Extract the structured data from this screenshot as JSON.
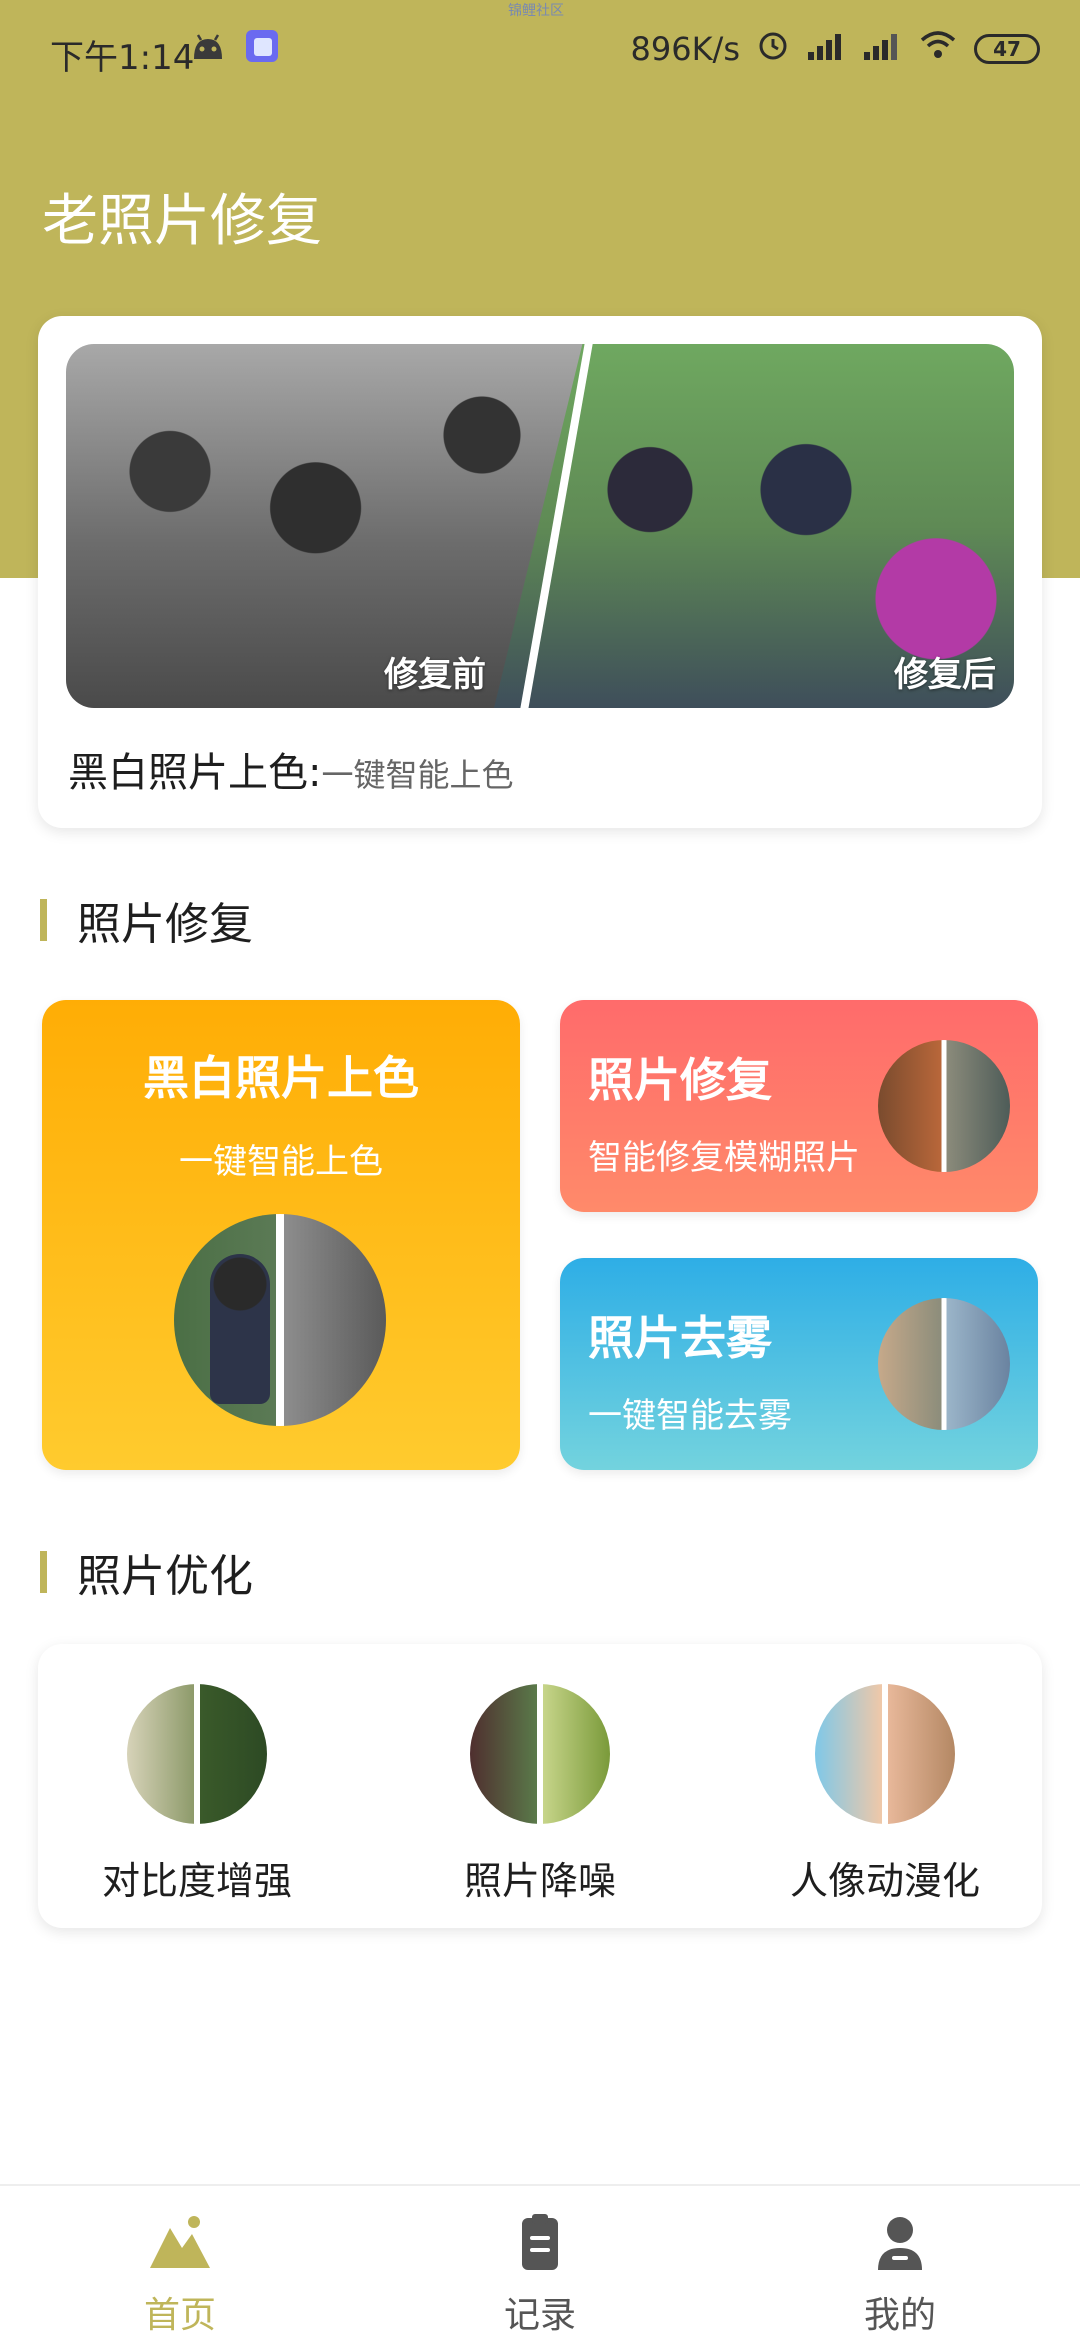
{
  "status_bar": {
    "time": "下午1:14",
    "network_speed": "896K/s",
    "battery": "47",
    "watermark": "锦鲤社区"
  },
  "header": {
    "title": "老照片修复",
    "background_color": "#bfb55a"
  },
  "banner": {
    "label_before": "修复前",
    "label_after": "修复后",
    "caption_title": "黑白照片上色:",
    "caption_sub": "一键智能上色"
  },
  "sections": {
    "repair_title": "照片修复",
    "optimize_title": "照片优化"
  },
  "feature_cards": {
    "colorize": {
      "title": "黑白照片上色",
      "subtitle": "一键智能上色",
      "color": "#ffad05"
    },
    "repair": {
      "title": "照片修复",
      "subtitle": "智能修复模糊照片",
      "color": "#ff6b6b"
    },
    "dehaze": {
      "title": "照片去雾",
      "subtitle": "一键智能去雾",
      "color": "#2eaee6"
    }
  },
  "optimize_items": [
    {
      "label": "对比度增强"
    },
    {
      "label": "照片降噪"
    },
    {
      "label": "人像动漫化"
    }
  ],
  "bottom_nav": {
    "items": [
      {
        "label": "首页",
        "icon": "mountain-icon",
        "active": true
      },
      {
        "label": "记录",
        "icon": "clipboard-icon",
        "active": false
      },
      {
        "label": "我的",
        "icon": "user-icon",
        "active": false
      }
    ],
    "active_color": "#bfb55a"
  }
}
